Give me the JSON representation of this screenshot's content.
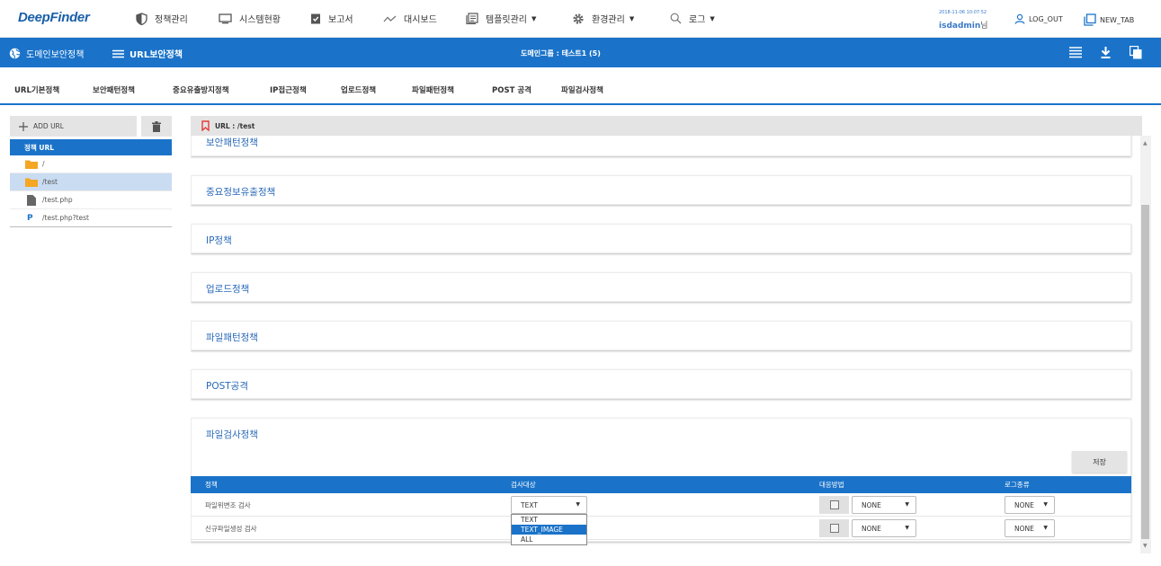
{
  "topbar": {
    "logo": "DeepFinder",
    "nav": [
      {
        "label": "정책관리",
        "icon": "shield-icon"
      },
      {
        "label": "시스템현황",
        "icon": "monitor-icon"
      },
      {
        "label": "보고서",
        "icon": "clipboard-icon"
      },
      {
        "label": "대시보드",
        "icon": "trend-icon"
      },
      {
        "label": "템플릿관리",
        "icon": "template-icon"
      },
      {
        "label": "환경관리",
        "icon": "gear-icon"
      },
      {
        "label": "로그",
        "icon": "search-icon"
      }
    ],
    "timestamp": "2018-11-06 10:07:52",
    "username": "isdadmin",
    "username_suffix": "님",
    "logout_label": "LOG_OUT",
    "newtab_label": "NEW_TAB"
  },
  "bluebar": {
    "section": "도메인보안정책",
    "subsection": "URL보안정책",
    "group": "도메인그룹 : 테스트1 (5)"
  },
  "tabs": [
    "URL기본정책",
    "보안패턴정책",
    "중요유출방지정책",
    "IP접근정책",
    "업로드정책",
    "파일패턴정책",
    "POST 공격",
    "파일검사정책"
  ],
  "sidebar": {
    "add_label": "ADD URL",
    "header": "정책 URL",
    "items": [
      {
        "label": "/",
        "icon": "folder-icon"
      },
      {
        "label": "/test",
        "icon": "folder-icon"
      },
      {
        "label": "/test.php",
        "icon": "file-icon"
      },
      {
        "label": "/test.php?test",
        "icon": "param-icon"
      }
    ]
  },
  "url_bar": {
    "label": "URL : /test"
  },
  "panels": [
    "보안패턴정책",
    "중요정보유출정책",
    "IP정책",
    "업로드정책",
    "파일패턴정책",
    "POST공격",
    "파일검사정책"
  ],
  "file_check": {
    "save_label": "저장",
    "columns": [
      "정책",
      "검사대상",
      "대응방법",
      "로그종류"
    ],
    "rows": [
      {
        "name": "파일위변조 검사",
        "target": "TEXT",
        "action": "NONE",
        "log": "NONE"
      },
      {
        "name": "신규파일생성 검사",
        "target": "",
        "action": "NONE",
        "log": "NONE"
      }
    ],
    "dropdown_options": [
      "TEXT",
      "TEXT_IMAGE",
      "ALL"
    ],
    "dropdown_selected": "TEXT_IMAGE"
  },
  "colors": {
    "primary": "#1a73c9",
    "panel_title": "#2a6ab8",
    "selected_row": "#c9dcf2"
  }
}
